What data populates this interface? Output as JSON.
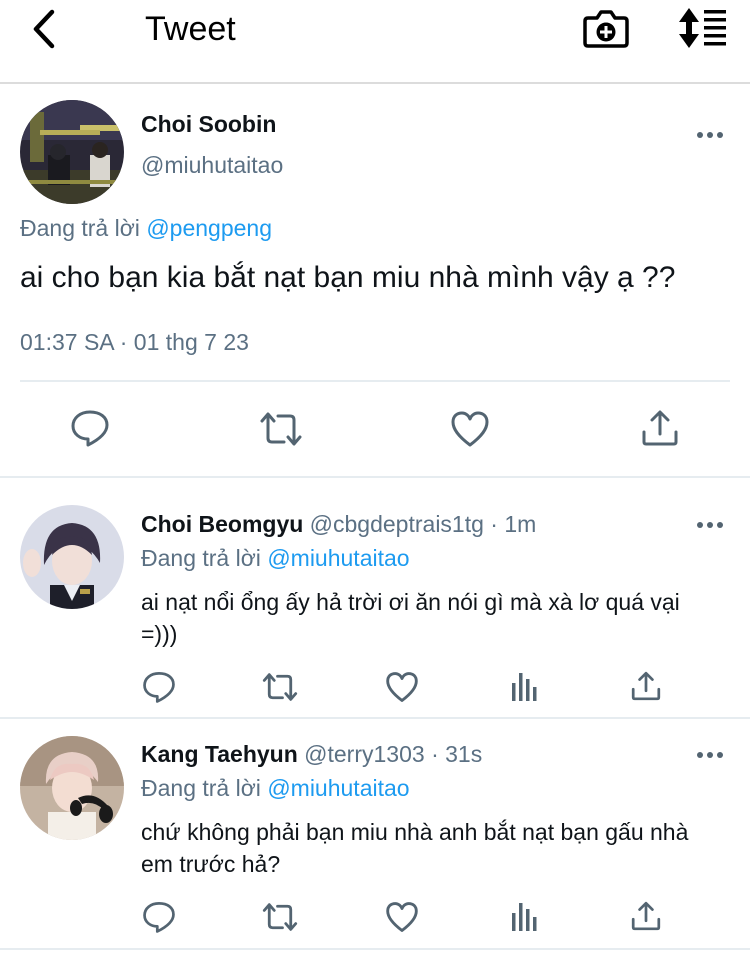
{
  "header": {
    "title": "Tweet",
    "icons": [
      "back-chevron-icon",
      "camera-plus-icon",
      "sort-list-icon"
    ]
  },
  "main_tweet": {
    "author_name": "Choi Soobin",
    "author_handle": "@miuhutaitao",
    "reply_prefix": "Đang trả lời",
    "reply_to": "@pengpeng",
    "text": "ai cho bạn kia bắt nạt bạn miu nhà mình vậy ạ ??",
    "timestamp": "01:37 SA · 01 thg 7 23",
    "actions": [
      "reply-icon",
      "retweet-icon",
      "like-icon",
      "share-icon"
    ]
  },
  "replies": [
    {
      "author_name": "Choi Beomgyu",
      "author_handle": "@cbgdeptrais1tg",
      "time": "· 1m",
      "reply_prefix": "Đang trả lời",
      "reply_to": "@miuhutaitao",
      "text": "ai nạt nổi ổng ấy hả trời ơi ăn nói gì mà xà lơ quá vại =)))",
      "actions": [
        "reply-icon",
        "retweet-icon",
        "like-icon",
        "analytics-icon",
        "share-icon"
      ]
    },
    {
      "author_name": "Kang Taehyun",
      "author_handle": "@terry1303",
      "time": "· 31s",
      "reply_prefix": "Đang trả lời",
      "reply_to": "@miuhutaitao",
      "text": "chứ không phải bạn miu nhà anh bắt nạt bạn gấu nhà em trước hả?",
      "actions": [
        "reply-icon",
        "retweet-icon",
        "like-icon",
        "analytics-icon",
        "share-icon"
      ]
    }
  ],
  "colors": {
    "accent": "#1d9bf0",
    "secondary_text": "#5b7083",
    "icon": "#536471",
    "divider": "#e6ecf0"
  }
}
